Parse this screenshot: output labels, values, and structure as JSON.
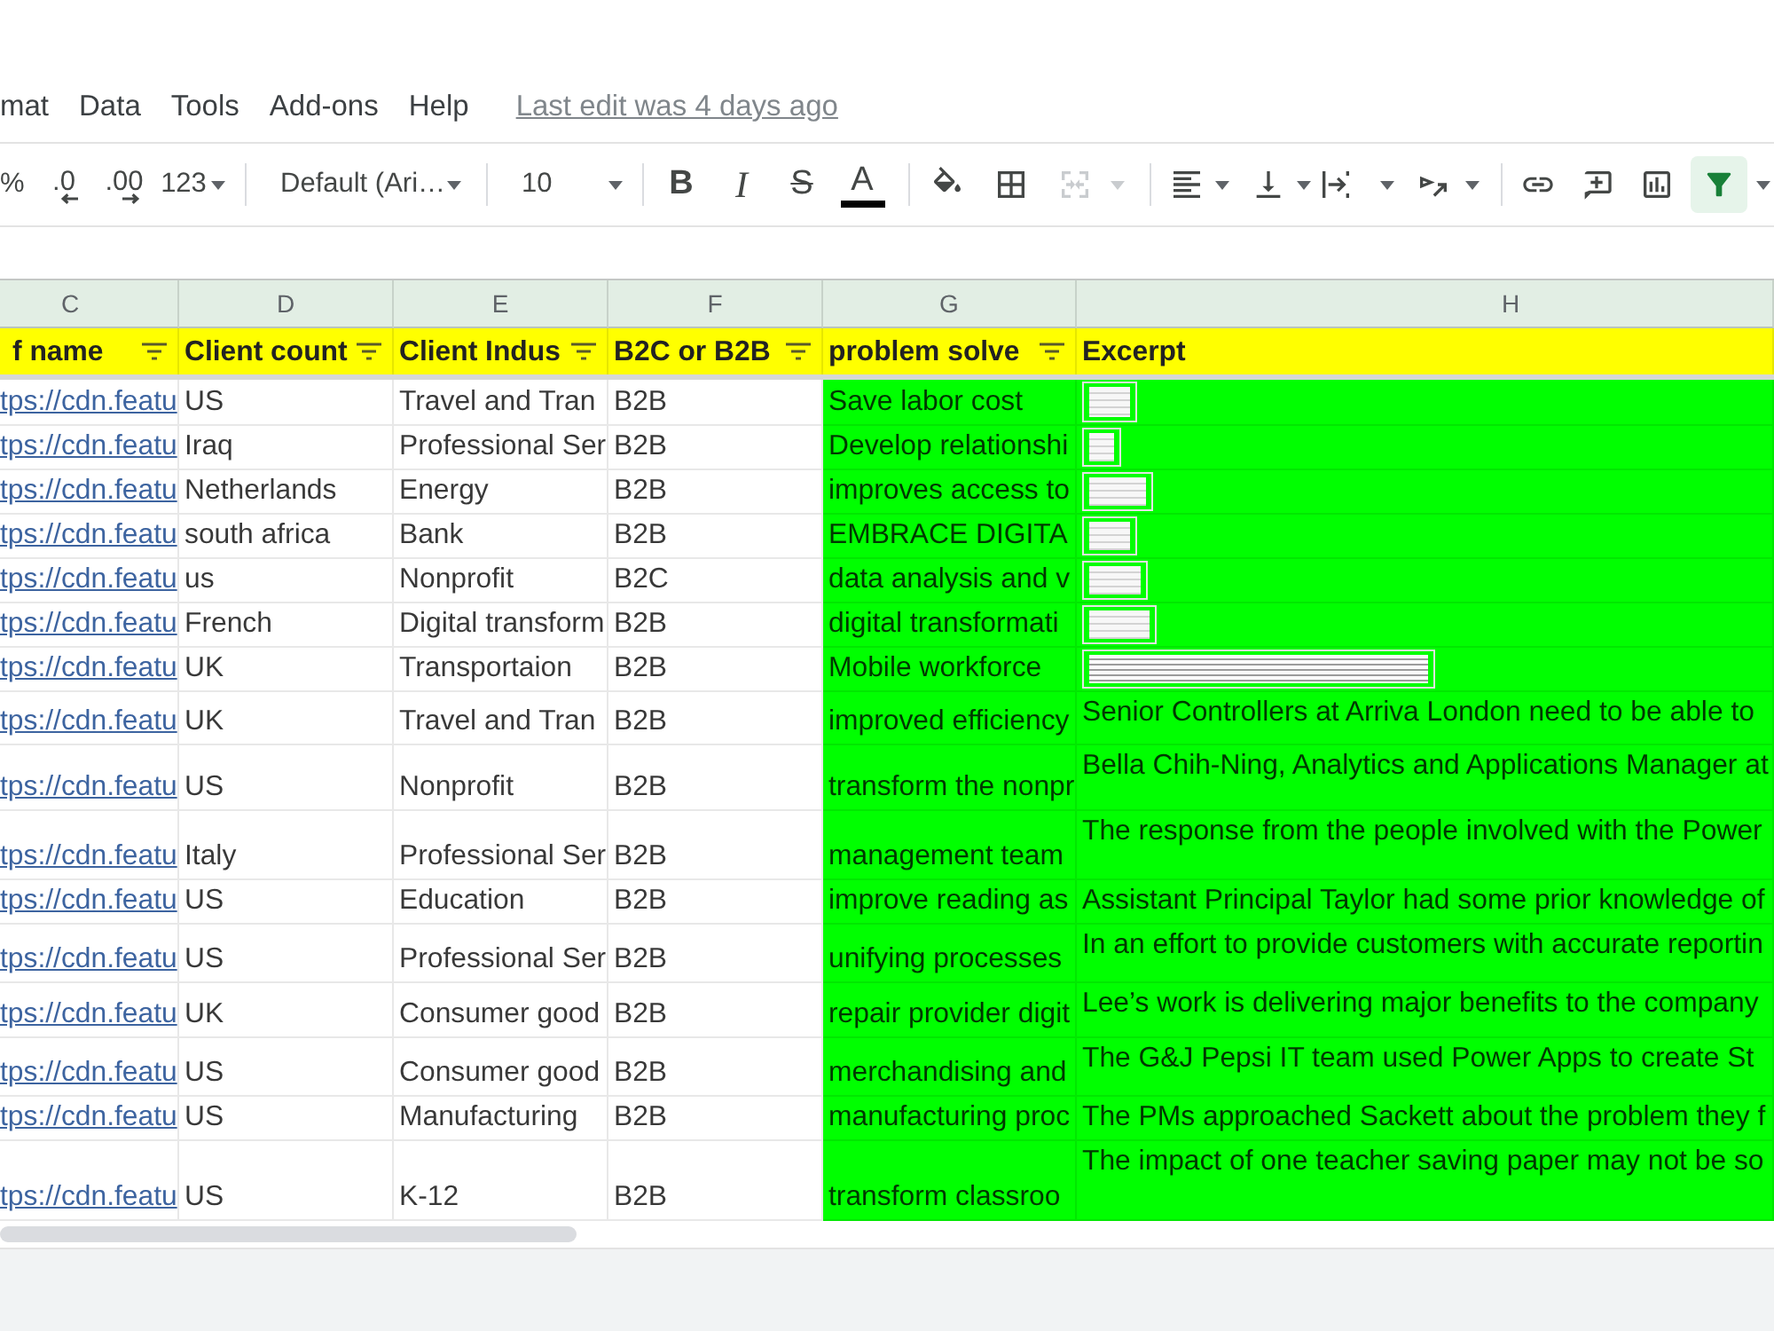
{
  "menu": {
    "items": [
      {
        "label": "mat"
      },
      {
        "label": "Data"
      },
      {
        "label": "Tools"
      },
      {
        "label": "Add-ons"
      },
      {
        "label": "Help"
      }
    ],
    "last_edit": "Last edit was 4 days ago"
  },
  "toolbar": {
    "format_buttons": [
      {
        "label": "%"
      },
      {
        "label": ".0"
      },
      {
        "label": ".00"
      },
      {
        "label": "123"
      }
    ],
    "font_menu": {
      "value": "Default (Ari…"
    },
    "size_menu": {
      "value": "10"
    },
    "style_buttons": [
      {
        "label": "B"
      },
      {
        "label": "I"
      },
      {
        "label": "S"
      },
      {
        "label": "A"
      }
    ],
    "merge_button": {
      "disabled": true
    },
    "filter_button": {
      "on": true
    }
  },
  "sheet": {
    "columns": [
      {
        "letter": "C",
        "header": "f name",
        "filter": true,
        "kind": "link",
        "color": "#ffffff"
      },
      {
        "letter": "D",
        "header": "Client count",
        "filter": true,
        "kind": "text",
        "color": "#ffffff"
      },
      {
        "letter": "E",
        "header": "Client Indus",
        "filter": true,
        "kind": "text",
        "color": "#ffffff"
      },
      {
        "letter": "F",
        "header": "B2C or B2B",
        "filter": true,
        "kind": "text",
        "color": "#ffffff"
      },
      {
        "letter": "G",
        "header": "problem solve",
        "filter": true,
        "kind": "text",
        "color": "#00ff00"
      },
      {
        "letter": "H",
        "header": "Excerpt",
        "filter": false,
        "kind": "excerpt",
        "color": "#00ff00"
      }
    ],
    "rows": [
      {
        "cells": [
          "tps://cdn.featu",
          "US",
          "Travel and Tran",
          "B2B",
          "Save labor cost"
        ],
        "excerpt": {
          "kind": "image"
        }
      },
      {
        "cells": [
          "tps://cdn.featu",
          "Iraq",
          "Professional Ser",
          "B2B",
          "Develop relationshi"
        ],
        "excerpt": {
          "kind": "image"
        }
      },
      {
        "cells": [
          "tps://cdn.featu",
          "Netherlands",
          "Energy",
          "B2B",
          "improves access to"
        ],
        "excerpt": {
          "kind": "image"
        }
      },
      {
        "cells": [
          "tps://cdn.featu",
          "south africa",
          "Bank",
          "B2B",
          "EMBRACE DIGITA"
        ],
        "excerpt": {
          "kind": "image"
        }
      },
      {
        "cells": [
          "tps://cdn.featu",
          "us",
          "Nonprofit",
          "B2C",
          "data analysis and v"
        ],
        "excerpt": {
          "kind": "image"
        }
      },
      {
        "cells": [
          "tps://cdn.featu",
          "French",
          "Digital transform",
          "B2B",
          "digital transformati"
        ],
        "excerpt": {
          "kind": "image"
        }
      },
      {
        "cells": [
          "tps://cdn.featu",
          "UK",
          "Transportaion",
          "B2B",
          "Mobile workforce"
        ],
        "excerpt": {
          "kind": "image"
        }
      },
      {
        "cells": [
          "tps://cdn.featu",
          "UK",
          "Travel and Tran",
          "B2B",
          "improved efficiency"
        ],
        "excerpt": {
          "kind": "text",
          "text": "Senior Controllers at Arriva London need to be able to"
        }
      },
      {
        "cells": [
          "tps://cdn.featu",
          "US",
          "Nonprofit",
          "B2B",
          "transform the nonpr"
        ],
        "excerpt": {
          "kind": "text",
          "text": "Bella Chih-Ning, Analytics and Applications Manager at"
        }
      },
      {
        "cells": [
          "tps://cdn.featu",
          "Italy",
          "Professional Ser",
          "B2B",
          "management team"
        ],
        "excerpt": {
          "kind": "text",
          "text": "The response from the people involved with the Power"
        }
      },
      {
        "cells": [
          "tps://cdn.featu",
          "US",
          "Education",
          "B2B",
          "improve reading as"
        ],
        "excerpt": {
          "kind": "text",
          "text": "Assistant Principal Taylor had some prior knowledge of"
        }
      },
      {
        "cells": [
          "tps://cdn.featu",
          "US",
          "Professional Ser",
          "B2B",
          "unifying processes"
        ],
        "excerpt": {
          "kind": "text",
          "text": "In an effort to provide customers with accurate reportin"
        }
      },
      {
        "cells": [
          "tps://cdn.featu",
          "UK",
          "Consumer good",
          "B2B",
          "repair provider digit"
        ],
        "excerpt": {
          "kind": "text",
          "text": "Lee’s work is delivering major benefits to the company"
        }
      },
      {
        "cells": [
          "tps://cdn.featu",
          "US",
          "Consumer good",
          "B2B",
          "merchandising and"
        ],
        "excerpt": {
          "kind": "text",
          "text": "The G&J Pepsi IT team used Power Apps to create St"
        }
      },
      {
        "cells": [
          "tps://cdn.featu",
          "US",
          "Manufacturing",
          "B2B",
          "manufacturing proc"
        ],
        "excerpt": {
          "kind": "text",
          "text": "The PMs approached Sackett about the problem they f"
        }
      },
      {
        "cells": [
          "tps://cdn.featu",
          "US",
          "K-12",
          "B2B",
          "transform classroo"
        ],
        "excerpt": {
          "kind": "text",
          "text": "The impact of one teacher saving paper may not be so"
        }
      }
    ]
  }
}
